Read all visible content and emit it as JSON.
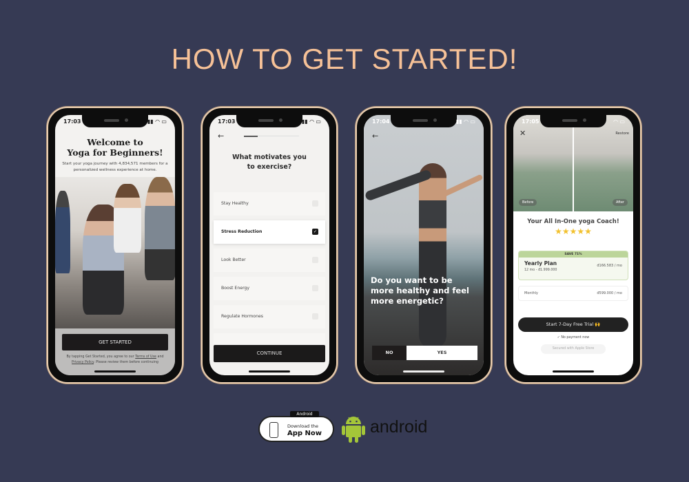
{
  "title": "HOW TO GET STARTED!",
  "phone1": {
    "time": "17:03",
    "title_l1": "Welcome to",
    "title_l2": "Yoga for Beginners!",
    "subtitle": "Start your yoga journey with 4,834,571 members for a personalized wellness experience at home.",
    "button": "GET STARTED",
    "legal_pre": "By tapping Get Started, you agree to our ",
    "terms": "Terms of Use",
    "and": " and ",
    "privacy": "Privacy Policy",
    "legal_post": ". Please review them before continuing"
  },
  "phone2": {
    "time": "17:03",
    "question_l1": "What motivates you",
    "question_l2": "to exercise?",
    "options": [
      {
        "label": "Stay Healthy",
        "checked": false
      },
      {
        "label": "Stress Reduction",
        "checked": true
      },
      {
        "label": "Look Better",
        "checked": false
      },
      {
        "label": "Boost Energy",
        "checked": false
      },
      {
        "label": "Regulate Hormones",
        "checked": false
      }
    ],
    "button": "CONTINUE"
  },
  "phone3": {
    "time": "17:04",
    "question": "Do you want to be more healthy and feel more energetic?",
    "no": "NO",
    "yes": "YES"
  },
  "phone4": {
    "time": "17:05",
    "restore": "Restore",
    "before": "Before",
    "after": "After",
    "headline": "Your All In-One yoga Coach!",
    "stars": 5,
    "save_badge": "SAVE 71%",
    "yearly_name": "Yearly Plan",
    "yearly_sub": "12 mo - đ1.999.000",
    "yearly_price": "đ166.583 / mo",
    "monthly_name": "Monthly",
    "monthly_price": "đ599.000 / mo",
    "cta": "Start 7-Day Free Trial 🙌",
    "no_payment": "✓ No payment now",
    "secured": "Secured with Apple Store"
  },
  "badge": {
    "tag": "Android",
    "line1": "Download the",
    "line2": "App Now"
  },
  "android": {
    "word": "android",
    "color": "#a4c639"
  }
}
